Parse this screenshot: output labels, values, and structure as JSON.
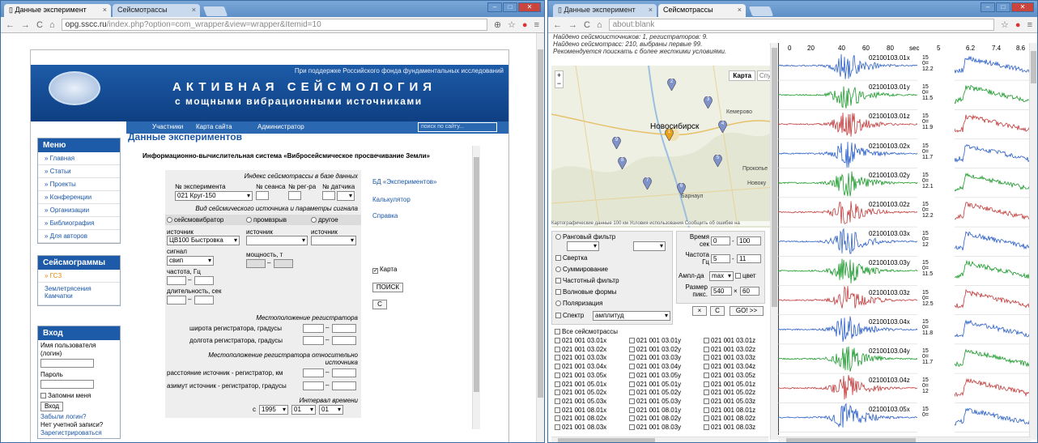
{
  "left": {
    "tabs": [
      {
        "label": "Данные эксперимент"
      },
      {
        "label": "Сейсмотрассы"
      }
    ],
    "url_host": "opg.sscc.ru",
    "url_path": "/index.php?option=com_wrapper&view=wrapper&Itemid=10",
    "support": "При поддержке Российского фонда фундаментальных исследований",
    "title1": "АКТИВНАЯ СЕЙСМОЛОГИЯ",
    "title2": "с мощными вибрационными источниками",
    "nav": [
      "Участники",
      "Карта сайта",
      "Администратор"
    ],
    "search_placeholder": "поиск по сайту...",
    "menu_title": "Меню",
    "menu": [
      "» Главная",
      "» Статьи",
      "» Проекты",
      "» Конференции",
      "» Организации",
      "» Библиография",
      "» Для авторов"
    ],
    "seis_title": "Сейсмограммы",
    "seis_items": [
      "» ГСЗ",
      "Землетрясения Камчатки"
    ],
    "login": {
      "title": "Вход",
      "user_label": "Имя пользователя (логин)",
      "pass_label": "Пароль",
      "remember": "Запомни меня",
      "button": "Вход",
      "forgot": "Забыли логин?",
      "noacc": "Нет учетной записи?",
      "register": "Зарегистрироваться"
    },
    "page_heading": "Данные экспериментов",
    "subheading": "Информационно-вычислительная система «Вибросейсмическое просвечивание Земли»",
    "form": {
      "index_caption": "Индекс сейсмотрассы в базе данных",
      "exp_label": "№ эксперимента",
      "exp_value": "021 Круг-150",
      "seans": "№ сеанса",
      "reg": "№ рег-ра",
      "sensor": "№ датчика",
      "source_caption": "Вид сейсмического источника и параметры сигнала",
      "radio": [
        "сейсмовибратор",
        "промвзрыв",
        "другое"
      ],
      "source_label": "источник",
      "source_value": "ЦВ100 Быстровка",
      "signal_label": "сигнал",
      "signal_value": "свип",
      "power_label": "мощность, т",
      "freq_label": "частота, Гц",
      "dur_label": "длительность, сек",
      "dash": "–",
      "reg_loc": "Местоположение регистратора",
      "lat": "широта регистратора, градусы",
      "lon": "долгота регистратора, градусы",
      "rel_loc": "Местоположение регистратора относительно источника",
      "dist": "расстояние источник - регистратор, км",
      "az": "азимут источник - регистратор, градусы",
      "time_caption": "Интервал времени",
      "from": "с",
      "year": "1995",
      "m": "01",
      "d": "01"
    },
    "links": [
      "БД «Экспериментов»",
      "Калькулятор",
      "Справка"
    ],
    "map_check": "Карта",
    "search_btn": "ПОИСК",
    "clear_btn": "С"
  },
  "right": {
    "tabs": [
      {
        "label": "Данные эксперимент"
      },
      {
        "label": "Сейсмотрассы"
      }
    ],
    "url": "about:blank",
    "info": [
      "Найдено сейсмоисточников: 1, регистраторов: 9.",
      "Найдено сейсмотрасс: 210, выбраны первые 99.",
      "Рекомендуется поискать с более жесткими условиями."
    ],
    "map": {
      "btn1": "Карта",
      "btn2": "Спу",
      "city": "Новосибирск",
      "kem": "Кемерово",
      "prok": "Прокопье",
      "novo": "Новоку",
      "barn": "Барнаул",
      "footer": "Картографические данные   100 км     Условия использования  Сообщить об ошибке на"
    },
    "pins": [
      "1",
      "2",
      "3",
      "4",
      "5",
      "6",
      "7",
      "8",
      "9"
    ],
    "filters": [
      "Ранговый фильтр",
      "Свертка",
      "Суммирование",
      "Частотный фильтр",
      "Волновые формы",
      "Поляризация",
      "Спектр"
    ],
    "spectrum_value": "амплитуд",
    "params": {
      "time_label": "Время сек",
      "t0": "0",
      "t1": "100",
      "freq_label": "Частота Гц",
      "f0": "5",
      "f1": "11",
      "amp_label": "Ампл-да",
      "amp_value": "max",
      "color": "цвет",
      "size_label": "Размер пикс.",
      "w": "540",
      "x": "×",
      "h": "60",
      "dash": "-"
    },
    "buttons": [
      "×",
      "C",
      "GO! >>"
    ],
    "all": "Все сейсмотрассы",
    "list": [
      [
        "021 001 03.01x",
        "021 001 03.01y",
        "021 001 03.01z"
      ],
      [
        "021 001 03.02x",
        "021 001 03.02y",
        "021 001 03.02z"
      ],
      [
        "021 001 03.03x",
        "021 001 03.03y",
        "021 001 03.03z"
      ],
      [
        "021 001 03.04x",
        "021 001 03.04y",
        "021 001 03.04z"
      ],
      [
        "021 001 03.05x",
        "021 001 03.05y",
        "021 001 03.05z"
      ],
      [
        "021 001 05.01x",
        "021 001 05.01y",
        "021 001 05.01z"
      ],
      [
        "021 001 05.02x",
        "021 001 05.02y",
        "021 001 05.02z"
      ],
      [
        "021 001 05.03x",
        "021 001 05.03y",
        "021 001 05.03z"
      ],
      [
        "021 001 08.01x",
        "021 001 08.01y",
        "021 001 08.01z"
      ],
      [
        "021 001 08.02x",
        "021 001 08.02y",
        "021 001 08.02z"
      ],
      [
        "021 001 08.03x",
        "021 001 08.03y",
        "021 001 08.03z"
      ]
    ],
    "axis": [
      "0",
      "20",
      "40",
      "60",
      "80",
      "sec"
    ],
    "axis2": [
      "5",
      "6.2",
      "7.4",
      "8.6"
    ],
    "traces": [
      {
        "id": "02100103.01x",
        "v1": "15",
        "v2": "12.2",
        "color": "#2b5fc7"
      },
      {
        "id": "02100103.01y",
        "v1": "15",
        "v2": "11.5",
        "color": "#1a9a2a"
      },
      {
        "id": "02100103.01z",
        "v1": "15",
        "v2": "11.9",
        "color": "#c23a3a"
      },
      {
        "id": "02100103.02x",
        "v1": "15",
        "v2": "11.7",
        "color": "#2b5fc7"
      },
      {
        "id": "02100103.02y",
        "v1": "15",
        "v2": "12.1",
        "color": "#1a9a2a"
      },
      {
        "id": "02100103.02z",
        "v1": "15",
        "v2": "12.2",
        "color": "#c23a3a"
      },
      {
        "id": "02100103.03x",
        "v1": "15",
        "v2": "12",
        "color": "#2b5fc7"
      },
      {
        "id": "02100103.03y",
        "v1": "15",
        "v2": "11.5",
        "color": "#1a9a2a"
      },
      {
        "id": "02100103.03z",
        "v1": "15",
        "v2": "12.5",
        "color": "#c23a3a"
      },
      {
        "id": "02100103.04x",
        "v1": "15",
        "v2": "11.8",
        "color": "#2b5fc7"
      },
      {
        "id": "02100103.04y",
        "v1": "15",
        "v2": "11.7",
        "color": "#1a9a2a"
      },
      {
        "id": "02100103.04z",
        "v1": "15",
        "v2": "12",
        "color": "#c23a3a"
      },
      {
        "id": "02100103.05x",
        "v1": "15",
        "v2": "",
        "color": "#2b5fc7"
      }
    ]
  }
}
